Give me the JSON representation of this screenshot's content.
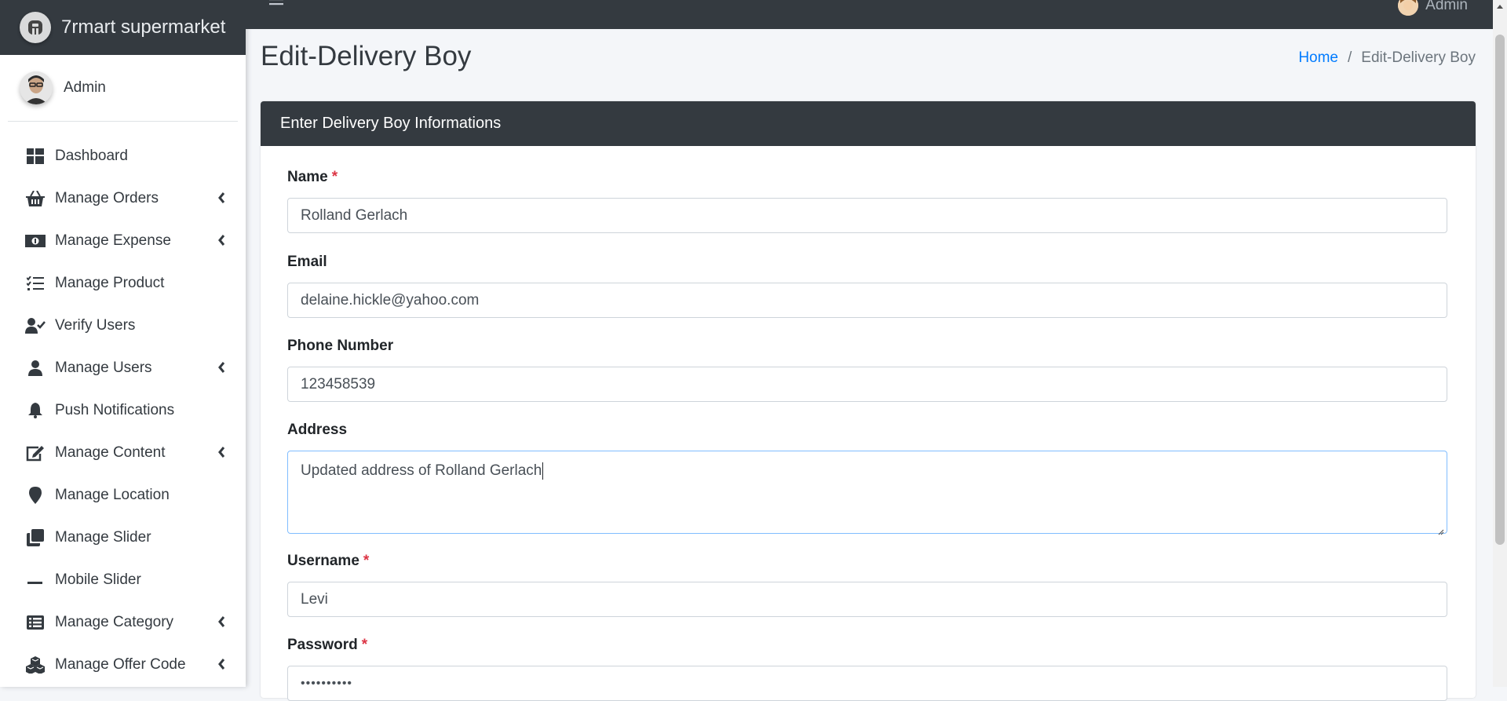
{
  "brand": {
    "name": "7rmart supermarket",
    "logo_icon": "brand-logo-icon"
  },
  "user": {
    "name": "Admin"
  },
  "topbar": {
    "user_name": "Admin"
  },
  "sidebar": {
    "items": [
      {
        "label": "Dashboard",
        "icon": "dashboard-icon",
        "has_submenu": false
      },
      {
        "label": "Manage Orders",
        "icon": "basket-icon",
        "has_submenu": true
      },
      {
        "label": "Manage Expense",
        "icon": "money-bill-icon",
        "has_submenu": true
      },
      {
        "label": "Manage Product",
        "icon": "tasks-icon",
        "has_submenu": false
      },
      {
        "label": "Verify Users",
        "icon": "user-check-icon",
        "has_submenu": false
      },
      {
        "label": "Manage Users",
        "icon": "user-icon",
        "has_submenu": true
      },
      {
        "label": "Push Notifications",
        "icon": "bell-icon",
        "has_submenu": false
      },
      {
        "label": "Manage Content",
        "icon": "edit-icon",
        "has_submenu": true
      },
      {
        "label": "Manage Location",
        "icon": "map-marker-icon",
        "has_submenu": false
      },
      {
        "label": "Manage Slider",
        "icon": "clone-icon",
        "has_submenu": false
      },
      {
        "label": "Mobile Slider",
        "icon": "minus-icon",
        "has_submenu": false
      },
      {
        "label": "Manage Category",
        "icon": "list-alt-icon",
        "has_submenu": true
      },
      {
        "label": "Manage Offer Code",
        "icon": "cubes-icon",
        "has_submenu": true
      }
    ]
  },
  "page": {
    "title": "Edit-Delivery Boy"
  },
  "breadcrumb": {
    "home": "Home",
    "separator": "/",
    "current": "Edit-Delivery Boy"
  },
  "card": {
    "title": "Enter Delivery Boy Informations"
  },
  "form": {
    "name": {
      "label": "Name",
      "required_mark": "*",
      "value": "Rolland Gerlach"
    },
    "email": {
      "label": "Email",
      "value": "delaine.hickle@yahoo.com"
    },
    "phone": {
      "label": "Phone Number",
      "value": "123458539"
    },
    "address": {
      "label": "Address",
      "value": "Updated address of Rolland Gerlach"
    },
    "username": {
      "label": "Username",
      "required_mark": "*",
      "value": "Levi"
    },
    "password": {
      "label": "Password",
      "required_mark": "*",
      "value": "••••••••••"
    }
  },
  "colors": {
    "sidebar_dark": "#343a40",
    "accent": "#007bff",
    "required": "#dc3545",
    "background": "#f4f6f9"
  }
}
